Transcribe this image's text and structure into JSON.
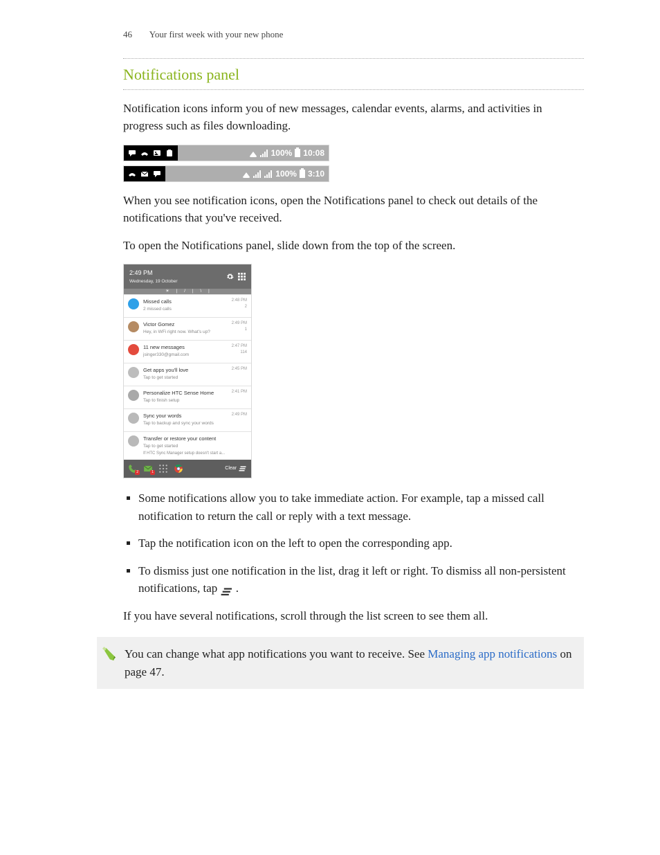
{
  "header": {
    "page_number": "46",
    "chapter": "Your first week with your new phone"
  },
  "section_title": "Notifications panel",
  "intro_para": "Notification icons inform you of new messages, calendar events, alarms, and activities in progress such as files downloading.",
  "statusbar1": {
    "battery_pct": "100%",
    "time": "10:08"
  },
  "statusbar2": {
    "battery_pct": "100%",
    "time": "3:10"
  },
  "para2": "When you see notification icons, open the Notifications panel to check out details of the notifications that you've received.",
  "para3": "To open the Notifications panel, slide down from the top of the screen.",
  "panel": {
    "time": "2:49 PM",
    "date": "Wednesday, 19 October",
    "notifications": [
      {
        "icon_color": "#2ea0e8",
        "title": "Missed calls",
        "sub": "2 missed calls",
        "time": "2:48 PM",
        "count": "2"
      },
      {
        "icon_color": "#b58b63",
        "title": "Victor Gomez",
        "sub": "Hey, in WFi right now. What's up?",
        "time": "2:49 PM",
        "count": "1"
      },
      {
        "icon_color": "#e34b3d",
        "title": "11 new messages",
        "sub": "jsinger330@gmail.com",
        "time": "2:47 PM",
        "count": "114"
      },
      {
        "icon_color": "#bdbdbd",
        "title": "Get apps you'll love",
        "sub": "Tap to get started",
        "time": "2:45 PM",
        "count": ""
      },
      {
        "icon_color": "#a9a9a9",
        "title": "Personalize HTC Sense Home",
        "sub": "Tap to finish setup",
        "time": "2:41 PM",
        "count": ""
      },
      {
        "icon_color": "#b9b9b9",
        "title": "Sync your words",
        "sub": "Tap to backup and sync your words",
        "time": "2:49 PM",
        "count": ""
      },
      {
        "icon_color": "#b9b9b9",
        "title": "Transfer or restore your content",
        "sub": "Tap to get started",
        "time": "",
        "count": "",
        "extra": "If HTC Sync Manager setup doesn't start a..."
      }
    ],
    "dock": {
      "phone_badge": "2",
      "mail_badge": "1",
      "clear_label": "Clear"
    }
  },
  "bullets": {
    "0": "Some notifications allow you to take immediate action. For example, tap a missed call notification to return the call or reply with a text message.",
    "1": "Tap the notification icon on the left to open the corresponding app.",
    "2a": "To dismiss just one notification in the list, drag it left or right. To dismiss all non-persistent notifications, tap ",
    "2b": " ."
  },
  "para4": "If you have several notifications, scroll through the list screen to see them all.",
  "tip": {
    "before": "You can change what app notifications you want to receive. See ",
    "link": "Managing app notifications",
    "after": " on page 47."
  }
}
